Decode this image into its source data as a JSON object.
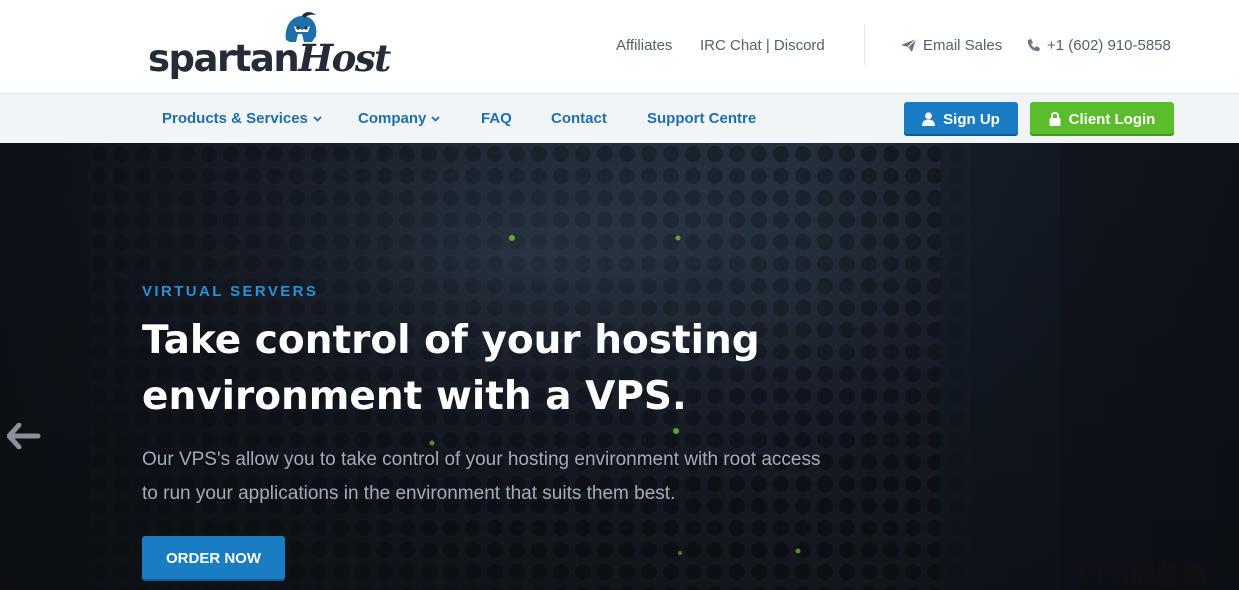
{
  "brand": {
    "logo_text_part1": "spartan",
    "logo_text_part2": "Host"
  },
  "header": {
    "links": {
      "affiliates": "Affiliates",
      "irc_chat": "IRC Chat | Discord"
    },
    "contact": {
      "email_label": "Email Sales",
      "email_icon": "paper-plane-icon",
      "phone_label": "+1 (602) 910-5858",
      "phone_icon": "phone-icon"
    }
  },
  "nav": {
    "products": "Products & Services",
    "company": "Company",
    "faq": "FAQ",
    "contact": "Contact",
    "support": "Support Centre",
    "signup_label": "Sign Up",
    "login_label": "Client Login"
  },
  "hero": {
    "eyebrow": "VIRTUAL SERVERS",
    "headline": "Take control of your hosting environment with a VPS.",
    "subtext": "Our VPS's allow you to take control of your hosting environment with root access to run your applications in the environment that suits them best.",
    "cta_label": "ORDER NOW",
    "prev_icon": "arrow-left-icon"
  },
  "watermark": "VPS那些事",
  "colors": {
    "accent_blue": "#1a7cc2",
    "accent_green": "#5bbd2b",
    "nav_text": "#1f6fa9",
    "eyebrow": "#2b8fd9"
  }
}
